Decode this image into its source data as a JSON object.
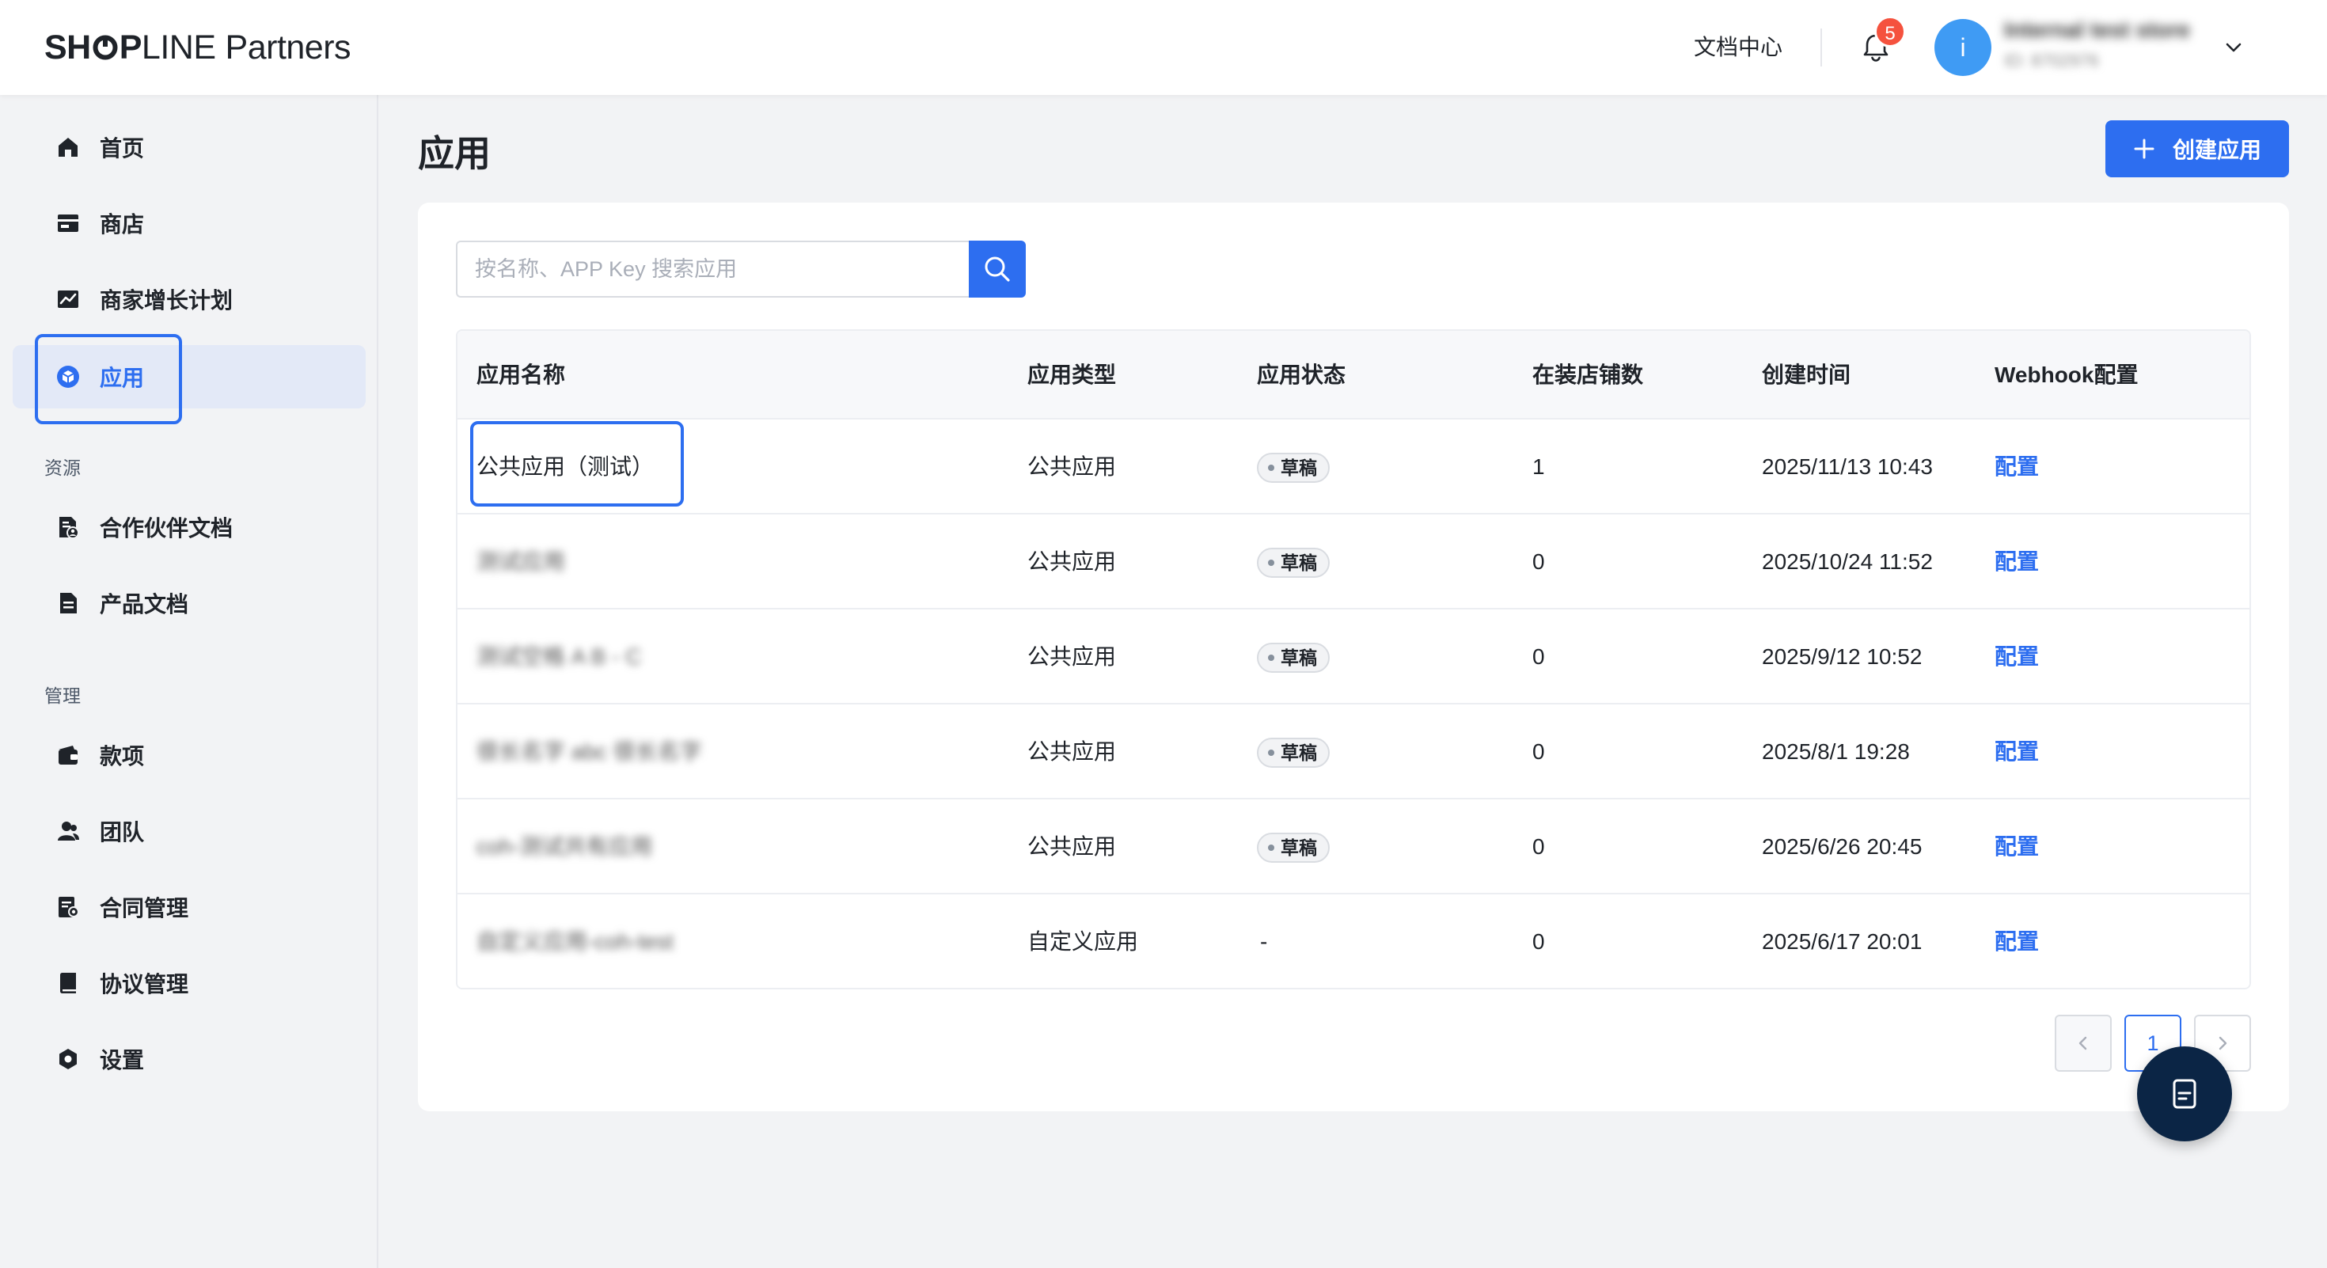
{
  "header": {
    "logo_bold_1": "SH",
    "logo_bold_2": "P",
    "logo_light_1": "LINE",
    "logo_light_2": "Partners",
    "doc_center": "文档中心",
    "notification_count": "5",
    "avatar_letter": "i",
    "account_name": "Internal test store",
    "account_id": "ID: 8702976"
  },
  "sidebar": {
    "items": [
      {
        "label": "首页",
        "icon": "home-icon"
      },
      {
        "label": "商店",
        "icon": "store-icon"
      },
      {
        "label": "商家增长计划",
        "icon": "growth-chart-icon"
      },
      {
        "label": "应用",
        "icon": "app-cube-icon",
        "active": true
      }
    ],
    "section_resources": "资源",
    "resources": [
      {
        "label": "合作伙伴文档",
        "icon": "partner-doc-icon"
      },
      {
        "label": "产品文档",
        "icon": "product-doc-icon"
      }
    ],
    "section_manage": "管理",
    "manage": [
      {
        "label": "款项",
        "icon": "wallet-icon"
      },
      {
        "label": "团队",
        "icon": "team-icon"
      },
      {
        "label": "合同管理",
        "icon": "contract-icon"
      },
      {
        "label": "协议管理",
        "icon": "agreement-icon"
      },
      {
        "label": "设置",
        "icon": "settings-icon"
      }
    ]
  },
  "main": {
    "title": "应用",
    "create_button": "创建应用",
    "search": {
      "placeholder": "按名称、APP Key 搜索应用",
      "value": ""
    },
    "table": {
      "headers": [
        "应用名称",
        "应用类型",
        "应用状态",
        "在装店铺数",
        "创建时间",
        "Webhook配置"
      ],
      "rows": [
        {
          "name": "公共应用（测试）",
          "type": "公共应用",
          "status": "草稿",
          "installs": "1",
          "created": "2025/11/13 10:43",
          "webhook": "配置"
        },
        {
          "name": "测试应用",
          "type": "公共应用",
          "status": "草稿",
          "installs": "0",
          "created": "2025/10/24 11:52",
          "webhook": "配置"
        },
        {
          "name": "测试空格 A B - C",
          "type": "公共应用",
          "status": "草稿",
          "installs": "0",
          "created": "2025/9/12 10:52",
          "webhook": "配置"
        },
        {
          "name": "很长名字 abc 很长名字",
          "type": "公共应用",
          "status": "草稿",
          "installs": "0",
          "created": "2025/8/1 19:28",
          "webhook": "配置"
        },
        {
          "name": "coh-测试共有应用",
          "type": "公共应用",
          "status": "草稿",
          "installs": "0",
          "created": "2025/6/26 20:45",
          "webhook": "配置"
        },
        {
          "name": "自定义应用-coh-test",
          "type": "自定义应用",
          "status": "-",
          "installs": "0",
          "created": "2025/6/17 20:01",
          "webhook": "配置"
        }
      ]
    },
    "pagination": {
      "current": "1",
      "prev": "‹",
      "next": "›"
    }
  },
  "colors": {
    "accent": "#2d6ef0",
    "badge_red": "#f5523e",
    "avatar": "#3f9bf4",
    "float_button": "#0b2545"
  }
}
